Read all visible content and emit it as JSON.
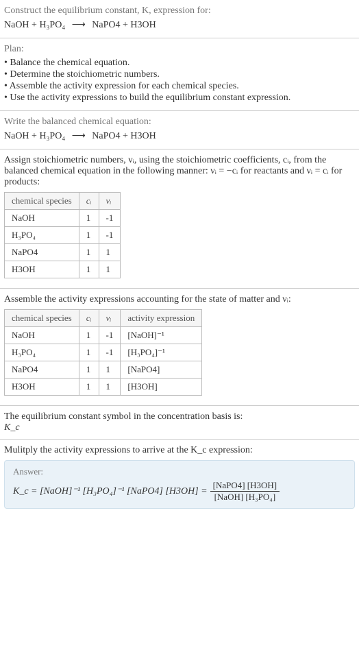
{
  "header": {
    "prompt": "Construct the equilibrium constant, K, expression for:",
    "equation_lhs": "NaOH + H₃PO₄",
    "equation_arrow": "⟶",
    "equation_rhs": "NaPO4 + H3OH"
  },
  "plan": {
    "title": "Plan:",
    "items": [
      "• Balance the chemical equation.",
      "• Determine the stoichiometric numbers.",
      "• Assemble the activity expression for each chemical species.",
      "• Use the activity expressions to build the equilibrium constant expression."
    ]
  },
  "balanced": {
    "prompt": "Write the balanced chemical equation:",
    "equation_lhs": "NaOH + H₃PO₄",
    "equation_arrow": "⟶",
    "equation_rhs": "NaPO4 + H3OH"
  },
  "stoich": {
    "intro": "Assign stoichiometric numbers, νᵢ, using the stoichiometric coefficients, cᵢ, from the balanced chemical equation in the following manner: νᵢ = −cᵢ for reactants and νᵢ = cᵢ for products:",
    "headers": [
      "chemical species",
      "cᵢ",
      "νᵢ"
    ],
    "rows": [
      [
        "NaOH",
        "1",
        "-1"
      ],
      [
        "H₃PO₄",
        "1",
        "-1"
      ],
      [
        "NaPO4",
        "1",
        "1"
      ],
      [
        "H3OH",
        "1",
        "1"
      ]
    ]
  },
  "activity": {
    "intro": "Assemble the activity expressions accounting for the state of matter and νᵢ:",
    "headers": [
      "chemical species",
      "cᵢ",
      "νᵢ",
      "activity expression"
    ],
    "rows": [
      [
        "NaOH",
        "1",
        "-1",
        "[NaOH]⁻¹"
      ],
      [
        "H₃PO₄",
        "1",
        "-1",
        "[H₃PO₄]⁻¹"
      ],
      [
        "NaPO4",
        "1",
        "1",
        "[NaPO4]"
      ],
      [
        "H3OH",
        "1",
        "1",
        "[H3OH]"
      ]
    ]
  },
  "symbol": {
    "intro": "The equilibrium constant symbol in the concentration basis is:",
    "value": "K_c"
  },
  "multiply": {
    "intro": "Mulitply the activity expressions to arrive at the K_c expression:"
  },
  "answer": {
    "label": "Answer:",
    "lhs": "K_c = [NaOH]⁻¹ [H₃PO₄]⁻¹ [NaPO4] [H3OH] =",
    "frac_num": "[NaPO4] [H3OH]",
    "frac_den": "[NaOH] [H₃PO₄]"
  },
  "chart_data": {
    "type": "table",
    "tables": [
      {
        "title": "Stoichiometric numbers",
        "columns": [
          "chemical species",
          "c_i",
          "nu_i"
        ],
        "rows": [
          {
            "chemical species": "NaOH",
            "c_i": 1,
            "nu_i": -1
          },
          {
            "chemical species": "H3PO4",
            "c_i": 1,
            "nu_i": -1
          },
          {
            "chemical species": "NaPO4",
            "c_i": 1,
            "nu_i": 1
          },
          {
            "chemical species": "H3OH",
            "c_i": 1,
            "nu_i": 1
          }
        ]
      },
      {
        "title": "Activity expressions",
        "columns": [
          "chemical species",
          "c_i",
          "nu_i",
          "activity expression"
        ],
        "rows": [
          {
            "chemical species": "NaOH",
            "c_i": 1,
            "nu_i": -1,
            "activity expression": "[NaOH]^-1"
          },
          {
            "chemical species": "H3PO4",
            "c_i": 1,
            "nu_i": -1,
            "activity expression": "[H3PO4]^-1"
          },
          {
            "chemical species": "NaPO4",
            "c_i": 1,
            "nu_i": 1,
            "activity expression": "[NaPO4]"
          },
          {
            "chemical species": "H3OH",
            "c_i": 1,
            "nu_i": 1,
            "activity expression": "[H3OH]"
          }
        ]
      }
    ]
  }
}
